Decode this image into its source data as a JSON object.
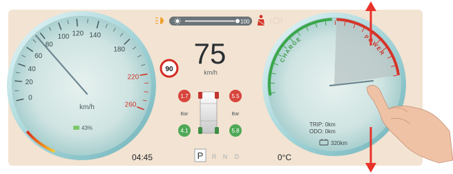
{
  "top_bar": {
    "brightness_value": "100"
  },
  "speedometer": {
    "ticks": [
      "0",
      "20",
      "40",
      "60",
      "80",
      "100",
      "120",
      "140",
      "180",
      "220",
      "260"
    ],
    "unit": "km/h",
    "battery_percent": "43%",
    "needle_value_kmh": 75
  },
  "center": {
    "speed": "75",
    "speed_unit": "km/h",
    "speed_limit": "90",
    "tires": {
      "front_left": "1.7",
      "front_right": "5.5",
      "rear_left": "4.1",
      "rear_right": "5.8",
      "unit_left": "Bar",
      "unit_right": "Bar"
    },
    "clock": "04:45",
    "gears": [
      "P",
      "R",
      "N",
      "D"
    ],
    "selected_gear": "P",
    "outside_temp": "0°C"
  },
  "power_gauge": {
    "charge_label": "CHARGE",
    "power_label": "POWER",
    "trip": "TRIP: 0km",
    "odo": "ODO: 0km",
    "range": "320km"
  },
  "colors": {
    "background": "#f3e3d2",
    "gauge_ring": "#9fd4d8",
    "accent_red": "#d4352b",
    "accent_green": "#3aa64a",
    "arrow_red": "#e8322a"
  }
}
